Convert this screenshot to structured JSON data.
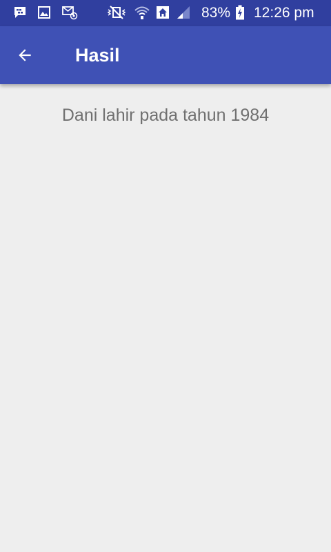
{
  "status_bar": {
    "battery_percent": "83%",
    "time": "12:26 pm",
    "left_icons": [
      "bbm-chat-icon",
      "gallery-icon",
      "email-notification-icon"
    ],
    "right_icons": [
      "vibrate-mute-icon",
      "wifi-icon",
      "home-network-icon",
      "signal-icon",
      "battery-charging-icon"
    ]
  },
  "app_bar": {
    "title": "Hasil",
    "background": "#3f51b5",
    "status_background": "#303f9f"
  },
  "main": {
    "result_text": "Dani lahir pada tahun 1984"
  }
}
